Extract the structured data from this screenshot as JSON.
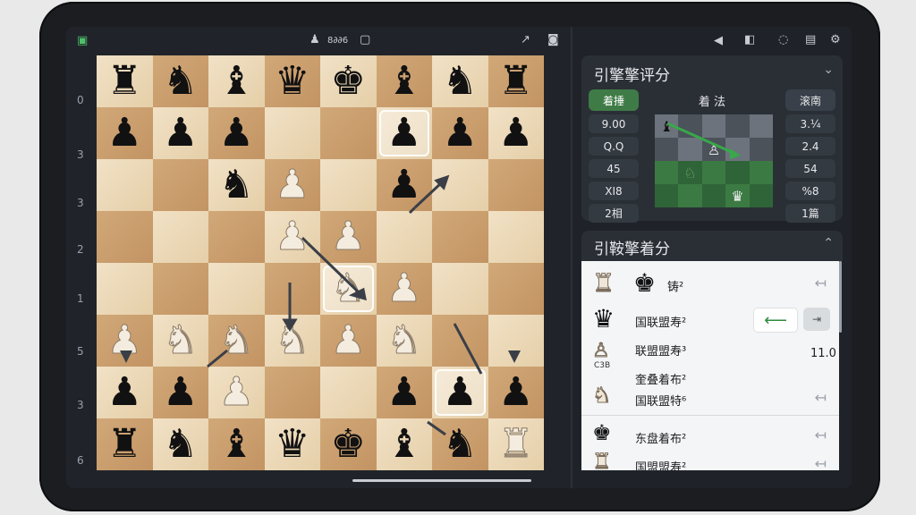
{
  "top_bar": {
    "status_text": "8∂∂6"
  },
  "board": {
    "ranks": [
      "0",
      "3",
      "3",
      "2",
      "1",
      "5",
      "3",
      "6"
    ],
    "rows": [
      [
        "br",
        "bn",
        "bb",
        "bq",
        "bk",
        "bb",
        "bn",
        "br"
      ],
      [
        "bp",
        "bp",
        "bp",
        "",
        "",
        "bp",
        "bp",
        "bp"
      ],
      [
        "",
        "",
        "bn",
        "wp",
        "",
        "bp",
        "",
        ""
      ],
      [
        "",
        "",
        "",
        "wp",
        "wp",
        "",
        "",
        ""
      ],
      [
        "",
        "",
        "",
        "",
        "wn",
        "wp",
        "",
        ""
      ],
      [
        "wp",
        "wn",
        "wn",
        "wn",
        "wp",
        "wn",
        "",
        ""
      ],
      [
        "bp",
        "bp",
        "wp",
        "",
        "",
        "bp",
        "bp",
        "bp"
      ],
      [
        "br",
        "bn",
        "bb",
        "bq",
        "bk",
        "bb",
        "bn",
        "wr"
      ]
    ]
  },
  "engine_panel": {
    "title": "引擎擎评分",
    "tab_left": "着捶",
    "tab_mid": "着 法",
    "tab_right": "滚南",
    "left_values": [
      "9.00",
      "Q.Q",
      "45",
      "XI8",
      "2相"
    ],
    "right_values": [
      "3.¼",
      "2.4",
      "54",
      "%8",
      "1篇"
    ]
  },
  "moves_panel": {
    "title": "引鞍擎着分",
    "rows": [
      {
        "text": "铸²"
      },
      {
        "text": "国联盟寿²"
      },
      {
        "text": "联盟盟寿³",
        "sub": "C3B",
        "value": "11.0"
      },
      {
        "text": "奎叠着布²"
      },
      {
        "text": "国联盟特⁶"
      },
      {
        "text": "东盘着布²"
      },
      {
        "text": "国盟盟寿²"
      }
    ]
  }
}
